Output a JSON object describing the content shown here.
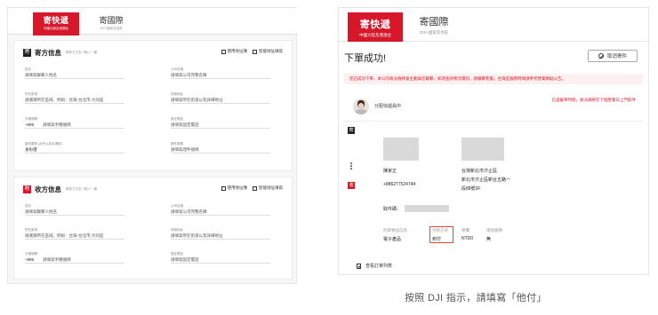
{
  "tabs": {
    "express": {
      "title": "寄快遞",
      "subtitle": "中國大陸及港澳台"
    },
    "international": {
      "title": "寄國際",
      "subtitle": "200+國家及地區"
    }
  },
  "sender": {
    "badge": "寄",
    "title": "寄方信息",
    "hint": "聯繫方式至少輸入一種",
    "action_address_book": "使用地址簿",
    "action_smart_fill": "智能地址填寫",
    "fields": {
      "name": {
        "label": "姓名",
        "value": "請填寫聯繫人姓名"
      },
      "company": {
        "label": "公司名稱",
        "value": "請填寫公司完整名稱"
      },
      "region": {
        "label": "所在區域",
        "value": "請選擇所在區域，例如：台灣-台北市-大同區"
      },
      "address": {
        "label": "詳細地址",
        "value": "請填寫所在街道以及詳細地址"
      },
      "mobile": {
        "label": "手機號碼",
        "code": "+886",
        "value": "請填寫手機號碼"
      },
      "phone": {
        "label": "固定電話",
        "value": "請填寫固定電話"
      },
      "id_type": {
        "label": "證件類別",
        "note": "(台灣公民自選填)",
        "value": "身份證"
      },
      "id_number": {
        "label": "證件號碼",
        "value": "請填寫證件號碼"
      }
    }
  },
  "receiver": {
    "badge": "收",
    "title": "收方信息",
    "hint": "聯繫方式至少輸入一種",
    "action_address_book": "使用地址簿",
    "action_smart_fill": "智能地址填寫",
    "fields": {
      "name": {
        "label": "姓名",
        "value": "請填寫聯繫人姓名"
      },
      "company": {
        "label": "公司名稱",
        "value": "請填寫公司完整名稱"
      },
      "region": {
        "label": "所在區域",
        "value": "請選擇所在區域，例如：台灣-台北市-大同區"
      },
      "address": {
        "label": "詳細地址",
        "value": "請填寫所在街道以及詳細地址"
      },
      "mobile": {
        "label": "手機號碼",
        "code": "+886",
        "value": "請填寫手機號碼"
      },
      "phone": {
        "label": "固定電話",
        "value": "請填寫固定電話"
      }
    }
  },
  "result": {
    "title": "下單成功!",
    "cancel_label": "取消寄件",
    "notice": "您已成功下單，本公司收派員將會主動與您聯繫，如須查詢物流資訊，請聯繫客服。台灣區服務時間請參考營業網點公告。",
    "courier_status": "分配快遞員中",
    "courier_note": "已過截單時間，收派員將在下個營業日上門取件",
    "sender_tag": "寄",
    "receiver_tag": "收",
    "receiver_name": "陳家正",
    "receiver_phone": "+886277524744",
    "receiver_address_1": "台灣新北市汐止區",
    "receiver_address_2": "新北市汐止區新台五路一",
    "receiver_address_3": "段88號3F",
    "pickup_code_label": "取件碼：",
    "info": {
      "goods_label": "托寄物品信息",
      "goods_value": "電子產品",
      "payment_label": "付款方式",
      "payment_value": "到付",
      "insured_label": "保價",
      "insured_value": "NTD0",
      "service_label": "增值服務",
      "service_value": "無"
    },
    "view_order_label": "查看訂單列表"
  },
  "caption": "按照 DJI 指示，請填寫「他付」",
  "colors": {
    "brand_red": "#d7182a",
    "highlight_box": "#e0443e"
  },
  "icons": [
    "address-book-icon",
    "smart-fill-icon",
    "cancel-icon",
    "avatar",
    "document-icon",
    "more-dots-icon"
  ]
}
